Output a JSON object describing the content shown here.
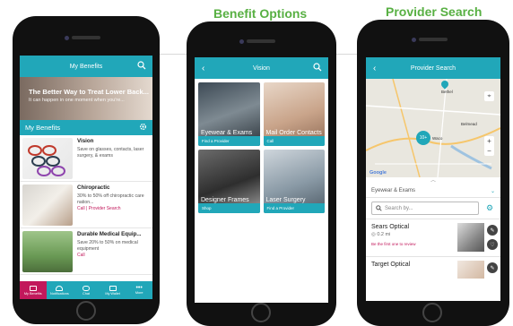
{
  "headings": {
    "benefit_options": "Benefit Options",
    "provider_search": "Provider Search"
  },
  "phone1": {
    "title": "My Benefits",
    "banner": {
      "title": "The Better Way to Treat Lower Back...",
      "subtitle": "It can happen in one moment when you're..."
    },
    "section_title": "My Benefits",
    "benefits": [
      {
        "title": "Vision",
        "desc": "Save on glasses, contacts, laser surgery, & exams",
        "links": ""
      },
      {
        "title": "Chiropractic",
        "desc": "30% to 50% off chiropractic care nation...",
        "links": "Call | Provider Search"
      },
      {
        "title": "Durable Medical Equip...",
        "desc": "Save 20% to 50% on medical equipment",
        "links": "Call"
      }
    ],
    "tabs": [
      {
        "label": "My Benefits",
        "icon": "home-icon"
      },
      {
        "label": "Notifications",
        "icon": "bell-icon"
      },
      {
        "label": "Chat",
        "icon": "chat-icon"
      },
      {
        "label": "My Wallet",
        "icon": "wallet-icon"
      },
      {
        "label": "More",
        "icon": "more-icon"
      }
    ]
  },
  "phone2": {
    "title": "Vision",
    "cards": [
      {
        "label": "Eyewear & Exams",
        "action": "Find a Provider"
      },
      {
        "label": "Mail Order Contacts",
        "action": "Call"
      },
      {
        "label": "Designer Frames",
        "action": "Shop"
      },
      {
        "label": "Laser Surgery",
        "action": "Find a Provider"
      }
    ]
  },
  "phone3": {
    "title": "Provider Search",
    "map": {
      "pin_count": "10+",
      "towns": [
        "Bethel",
        "Belmead",
        "Waco"
      ],
      "attribution": "Google",
      "zoom_in": "+",
      "zoom_out": "−"
    },
    "filter": "Eyewear & Exams",
    "search_placeholder": "Search by...",
    "providers": [
      {
        "name": "Sears Optical",
        "distance": "0.2 mi",
        "review": "Be the first one to review"
      },
      {
        "name": "Target Optical",
        "distance": "",
        "review": ""
      }
    ]
  },
  "colors": {
    "teal": "#21a7b9",
    "green": "#58b043",
    "magenta": "#c2185b"
  }
}
